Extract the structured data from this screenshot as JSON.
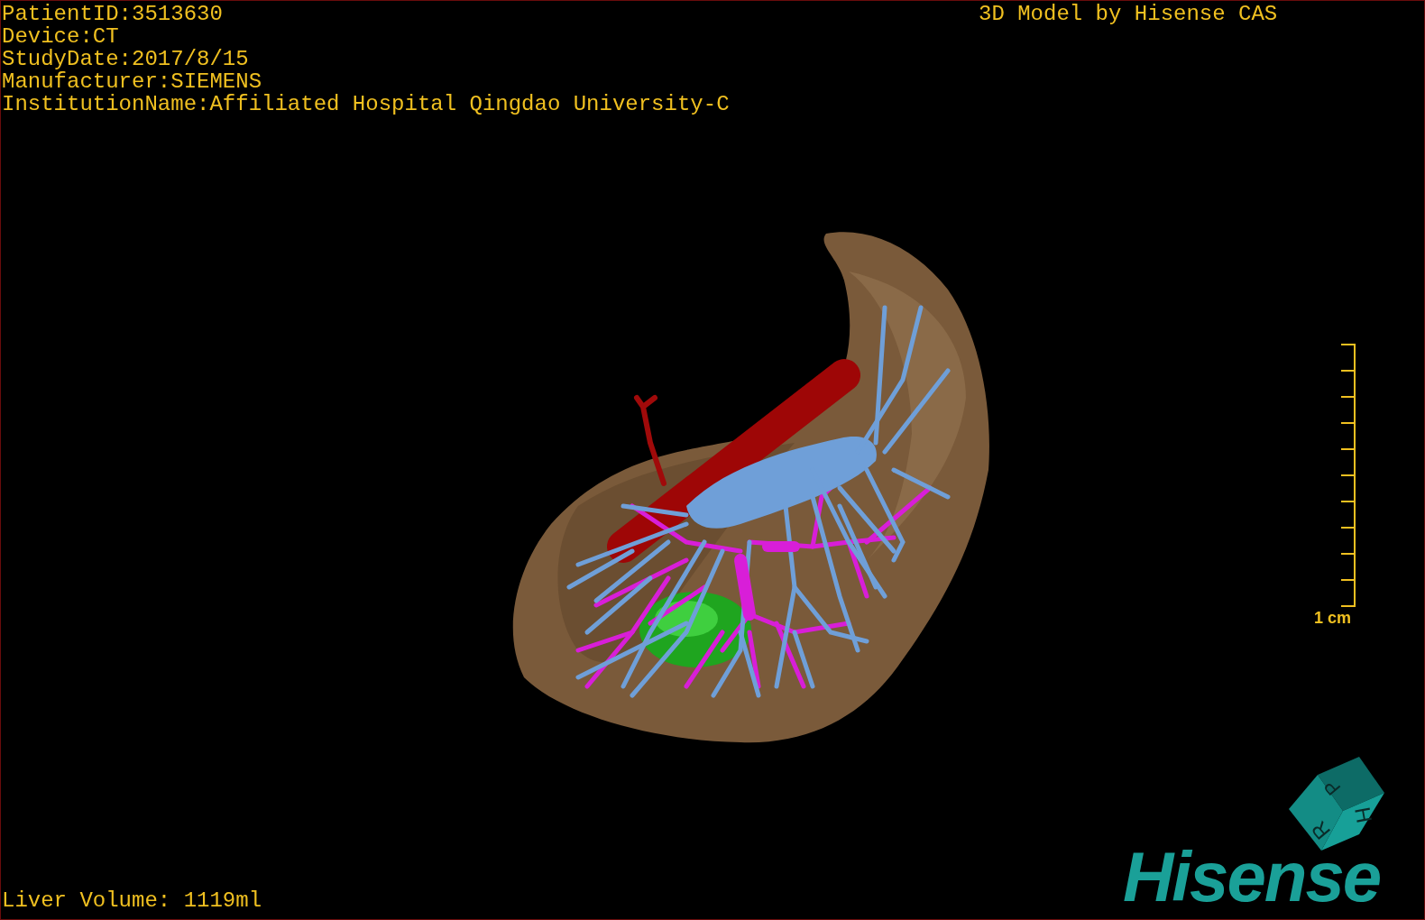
{
  "study_info": [
    "PatientID:3513630",
    "Device:CT",
    "StudyDate:2017/8/15",
    "Manufacturer:SIEMENS",
    "InstitutionName:Affiliated Hospital Qingdao University-C"
  ],
  "title": "3D Model by Hisense CAS",
  "scale_bar": {
    "label": "1 cm"
  },
  "orientation_cube": {
    "faces": [
      "P",
      "H",
      "R"
    ]
  },
  "logo": "Hisense",
  "liver_volume": "Liver Volume: 1119ml"
}
